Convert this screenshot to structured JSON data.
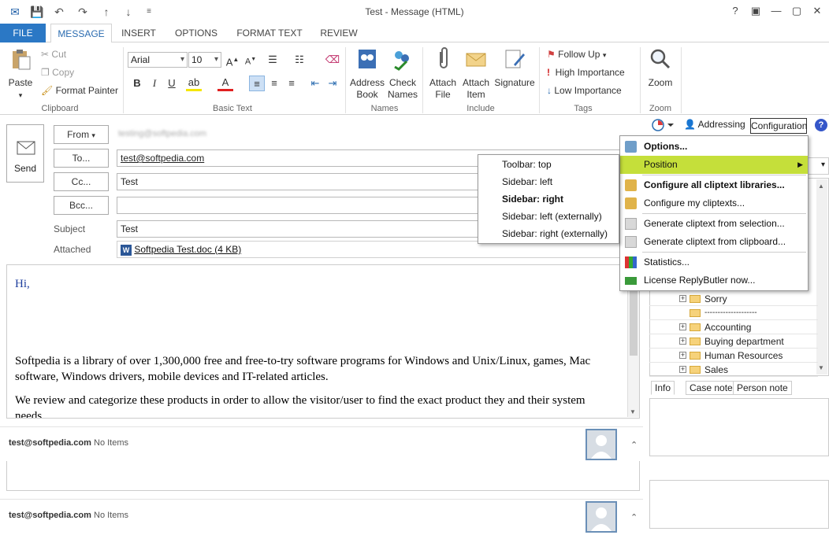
{
  "window": {
    "title": "Test - Message (HTML)"
  },
  "tabs": [
    "FILE",
    "MESSAGE",
    "INSERT",
    "OPTIONS",
    "FORMAT TEXT",
    "REVIEW"
  ],
  "ribbon": {
    "clipboard": {
      "paste": "Paste",
      "cut": "Cut",
      "copy": "Copy",
      "format_painter": "Format Painter",
      "label": "Clipboard"
    },
    "basic_text": {
      "font": "Arial",
      "size": "10",
      "label": "Basic Text"
    },
    "names": {
      "address_book": "Address Book",
      "check_names": "Check Names",
      "label": "Names"
    },
    "include": {
      "attach_file": "Attach File",
      "attach_item": "Attach Item",
      "signature": "Signature",
      "label": "Include"
    },
    "tags": {
      "follow_up": "Follow Up",
      "high_importance": "High Importance",
      "low_importance": "Low Importance",
      "label": "Tags"
    },
    "zoom": {
      "zoom": "Zoom",
      "label": "Zoom"
    }
  },
  "compose": {
    "send": "Send",
    "from_btn": "From",
    "from_value": "testing@softpedia.com",
    "to_btn": "To...",
    "to_value": "test@softpedia.com",
    "cc_btn": "Cc...",
    "cc_value": "Test",
    "bcc_btn": "Bcc...",
    "bcc_value": "",
    "subject_label": "Subject",
    "subject_value": "Test",
    "attached_label": "Attached",
    "attachment": "Softpedia Test.doc (4 KB)"
  },
  "body": {
    "greeting": "Hi,",
    "para1": "Softpedia is a library of over 1,300,000 free and free-to-try software programs for Windows and Unix/Linux, games, Mac software, Windows drivers, mobile devices and IT-related articles.",
    "para2": "We review and categorize these products in order to allow the visitor/user to find the exact product they and their system needs."
  },
  "people_pane": [
    {
      "email": "test@softpedia.com",
      "status": "No Items"
    },
    {
      "email": "test@softpedia.com",
      "status": "No Items"
    }
  ],
  "replybutler": {
    "addressing": "Addressing",
    "configuration": "Configuration",
    "menu": [
      "Options...",
      "Position",
      "Configure all cliptext libraries...",
      "Configure my cliptexts...",
      "Generate cliptext from selection...",
      "Generate cliptext from clipboard...",
      "Statistics...",
      "License ReplyButler now..."
    ],
    "position_submenu": [
      "Toolbar: top",
      "Sidebar: left",
      "Sidebar: right",
      "Sidebar: left (externally)",
      "Sidebar: right (externally)"
    ],
    "tree": [
      "Sorry",
      "--------------------",
      "Accounting",
      "Buying department",
      "Human Resources",
      "Sales"
    ],
    "bottom_tabs": [
      "Info",
      "Case note",
      "Person note"
    ]
  },
  "colors": {
    "accent": "#2b78c5",
    "highlight": "#c5df3a"
  }
}
